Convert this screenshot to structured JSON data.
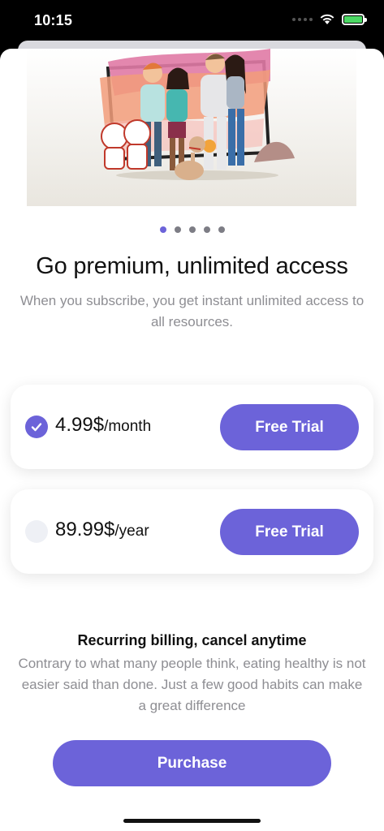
{
  "status_bar": {
    "time": "10:15",
    "battery_color": "#4cd964"
  },
  "pager": {
    "total": 5,
    "active": 0,
    "active_color": "#6c63d9"
  },
  "header": {
    "title": "Go premium, unlimited access",
    "subtitle": "When you subscribe, you get instant unlimited access to all resources."
  },
  "plans": [
    {
      "amount": "4.99$",
      "period": "/month",
      "button_label": "Free Trial",
      "selected": true
    },
    {
      "amount": "89.99$",
      "period": "/year",
      "button_label": "Free Trial",
      "selected": false
    }
  ],
  "billing": {
    "title": "Recurring billing, cancel anytime",
    "text": "Contrary to what many people think, eating healthy is not easier said than done. Just a few good habits can make a great difference"
  },
  "purchase": {
    "label": "Purchase"
  },
  "colors": {
    "accent": "#6c63d9",
    "muted_text": "#8e8e93"
  }
}
